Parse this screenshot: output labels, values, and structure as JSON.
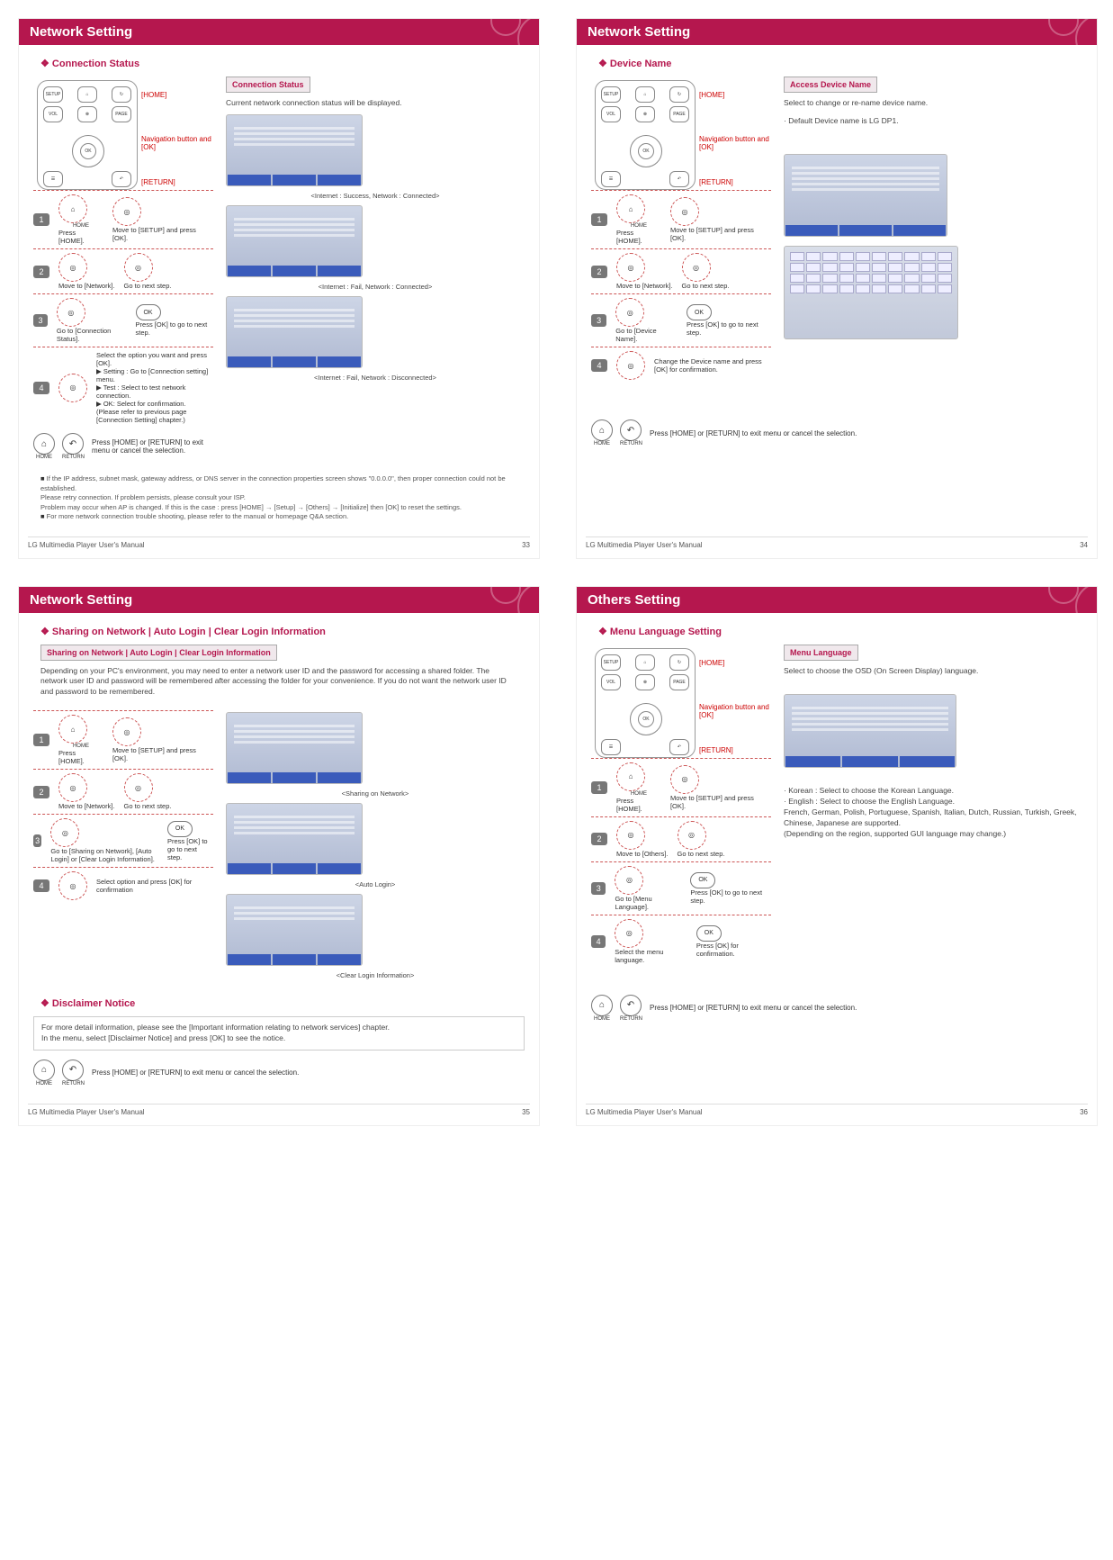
{
  "manual_title": "LG Multimedia Player User's Manual",
  "p33": {
    "header": "Network Setting",
    "sub": "Connection Status",
    "remote": {
      "home": "[HOME]",
      "nav": "Navigation button and [OK]",
      "return": "[RETURN]"
    },
    "panel_title": "Connection Status",
    "panel_body": "Current network connection status will be displayed.",
    "shot1": "<Internet : Success, Network : Connected>",
    "shot2": "<Internet : Fail, Network : Connected>",
    "shot3": "<Internet : Fail, Network : Disconnected>",
    "step1a": "Press [HOME].",
    "step1b": "Move to [SETUP] and press [OK].",
    "step2a": "Move to [Network].",
    "step2b": "Go to next step.",
    "step3a": "Go to [Connection Status].",
    "step3b": "Press [OK] to go  to next step.",
    "step4": "Select the option you want and press [OK].\n▶ Setting : Go to [Connection setting] menu.\n▶ Test : Select to test network connection.\n▶ OK: Select for confirmation.\n(Please refer to previous page [Connection Setting] chapter.)",
    "exit": "Press [HOME] or [RETURN] to exit menu or cancel the selection.",
    "note1": "If the IP address, subnet mask, gateway address, or DNS server in the connection properties screen shows \"0.0.0.0\", then proper connection could not be established.\nPlease retry connection. If problem persists, please consult your ISP.\nProblem may occur when AP is changed. If this is the case : press [HOME] → [Setup] → [Others] → [Initialize] then [OK] to reset the settings.",
    "note2": "For more network connection trouble shooting, please refer to the manual or homepage Q&A section.",
    "page": "33"
  },
  "p34": {
    "header": "Network Setting",
    "sub": "Device Name",
    "remote": {
      "home": "[HOME]",
      "nav": "Navigation button and [OK]",
      "return": "[RETURN]"
    },
    "panel_title": "Access Device Name",
    "panel_body": "Select to change or re-name device name.",
    "panel_note": "· Default Device name is LG DP1.",
    "step1a": "Press [HOME].",
    "step1b": "Move to [SETUP] and press [OK].",
    "step2a": "Move to [Network].",
    "step2b": "Go to next step.",
    "step3a": "Go to [Device Name].",
    "step3b": "Press [OK] to go  to next step.",
    "step4": "Change the Device name and  press [OK] for confirmation.",
    "exit": "Press [HOME] or [RETURN] to exit menu or cancel the selection.",
    "page": "34"
  },
  "p35": {
    "header": "Network Setting",
    "sub": "Sharing on Network | Auto Login | Clear Login Information",
    "panel_title": "Sharing on Network | Auto Login | Clear Login Information",
    "intro": "Depending on your PC's environment, you may need to enter a network user ID and the password for accessing a shared folder. The network user ID and password will be remembered after accessing the folder for your convenience. If you do not want the network user ID and password to be remembered.",
    "step1a": "Press [HOME].",
    "step1b": "Move to [SETUP] and press [OK].",
    "step2a": "Move to [Network].",
    "step2b": "Go to next step.",
    "step3a": "Go to [Sharing on Network], [Auto Login] or [Clear Login Information].",
    "step3b": "Press [OK] to go  to next step.",
    "step4": "Select option and press [OK] for confirmation",
    "shot1": "<Sharing on Network>",
    "shot2": "<Auto Login>",
    "shot3": "<Clear Login Information>",
    "sub2": "Disclaimer Notice",
    "box": "For more detail information, please see the [Important information relating to network services] chapter.\nIn the menu, select [Disclaimer Notice] and press [OK] to see the notice.",
    "exit": "Press [HOME] or [RETURN] to exit menu or cancel the selection.",
    "page": "35"
  },
  "p36": {
    "header": "Others Setting",
    "sub": "Menu Language Setting",
    "remote": {
      "home": "[HOME]",
      "nav": "Navigation button and [OK]",
      "return": "[RETURN]"
    },
    "panel_title": "Menu Language",
    "panel_body": "Select to choose the OSD (On Screen Display) language.",
    "step1a": "Press [HOME].",
    "step1b": "Move to [SETUP] and press [OK].",
    "step2a": "Move to [Others].",
    "step2b": "Go to next step.",
    "step3a": "Go to [Menu Language].",
    "step3b": "Press [OK] to go  to next step.",
    "step4a": "Select the menu language.",
    "step4b": "Press [OK] for confirmation.",
    "langs": "· Korean : Select to choose the Korean Language.\n· English : Select to choose the English Language.\nFrench, German, Polish, Portuguese, Spanish, Italian, Dutch, Russian, Turkish, Greek, Chinese, Japanese are supported.\n(Depending on the region, supported GUI language may change.)",
    "exit": "Press [HOME] or [RETURN] to exit menu or cancel the selection.",
    "page": "36"
  },
  "labels": {
    "home": "HOME",
    "return": "RETURN",
    "ok": "OK",
    "setup": "SETUP",
    "vol": "VOL",
    "page_lbl": "PAGE",
    "mute": "⊗"
  }
}
